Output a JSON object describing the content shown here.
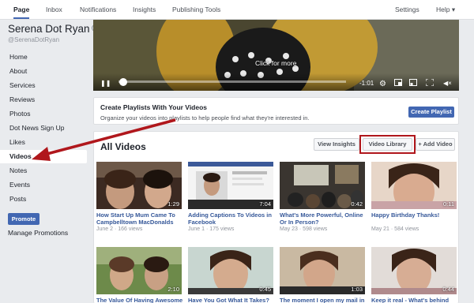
{
  "nav": {
    "tabs": [
      "Page",
      "Inbox",
      "Notifications",
      "Insights",
      "Publishing Tools"
    ],
    "settings": "Settings",
    "help": "Help ▾"
  },
  "sidebar": {
    "page_name": "Serena Dot Ryan",
    "handle": "@SerenaDotRyan",
    "items": [
      "Home",
      "About",
      "Services",
      "Reviews",
      "Photos",
      "Dot News Sign Up",
      "Likes",
      "Videos",
      "Notes",
      "Events",
      "Posts"
    ],
    "active_item": "Videos",
    "promote": "Promote",
    "manage_promotions": "Manage Promotions"
  },
  "player": {
    "overlay": "Click for more",
    "time": "-1:01",
    "progress": 0.02
  },
  "playlist_card": {
    "title": "Create Playlists With Your Videos",
    "description": "Organize your videos into playlists to help people find what they're interested in.",
    "button": "Create Playlist"
  },
  "videos_section": {
    "title": "All Videos",
    "view_insights": "View Insights",
    "video_library": "Video Library",
    "add_video": "+ Add Video"
  },
  "videos": [
    {
      "title": "How Start Up Mum Came To Campbelltown MacDonalds",
      "meta": "June 2 · 166 views",
      "duration": "1:29"
    },
    {
      "title": "Adding Captions To Videos in Facebook",
      "meta": "June 1 · 175 views",
      "duration": "7:04"
    },
    {
      "title": "What's More Powerful, Online Or In Person?",
      "meta": "May 23 · 598 views",
      "duration": "0:42"
    },
    {
      "title": "Happy Birthday Thanks!",
      "meta": "May 21 · 584 views",
      "duration": "0:11"
    },
    {
      "title": "The Value Of Having Awesome",
      "meta": "",
      "duration": "2:10"
    },
    {
      "title": "Have You Got What It Takes?",
      "meta": "",
      "duration": "0:45"
    },
    {
      "title": "The moment I open my mail in",
      "meta": "",
      "duration": "1:03"
    },
    {
      "title": "Keep it real - What's behind",
      "meta": "",
      "duration": "0:44"
    }
  ]
}
